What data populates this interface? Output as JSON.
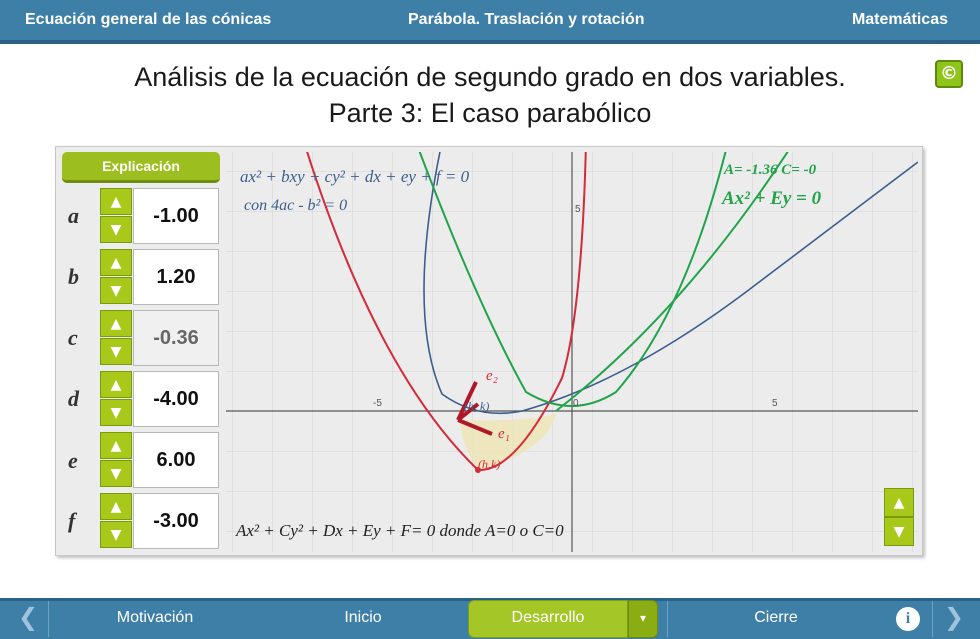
{
  "header": {
    "left_title": "Ecuación general de las cónicas",
    "center_title": "Parábola. Traslación y rotación",
    "right_title": "Matemáticas"
  },
  "copyright_icon": "©",
  "title": {
    "line1": "Análisis de la ecuación de segundo grado en dos variables.",
    "line2": "Parte 3: El caso parabólico"
  },
  "explanation_button": "Explicación",
  "params": [
    {
      "label": "a",
      "value": "-1.00",
      "disabled": false
    },
    {
      "label": "b",
      "value": "1.20",
      "disabled": false
    },
    {
      "label": "c",
      "value": "-0.36",
      "disabled": true
    },
    {
      "label": "d",
      "value": "-4.00",
      "disabled": false
    },
    {
      "label": "e",
      "value": "6.00",
      "disabled": false
    },
    {
      "label": "f",
      "value": "-3.00",
      "disabled": false
    }
  ],
  "stepper_up_icon": "▲",
  "stepper_down_icon": "▼",
  "graph": {
    "eq_general": "ax² + bxy + cy² + dx + ey + f = 0",
    "eq_condition": "con  4ac - b² = 0",
    "eq_coeffs": "A= -1.36   C= -0",
    "eq_reduced": "Ax² + Ey = 0",
    "eq_bottom": "Ax² + Cy² + Dx + Ey + F= 0  donde A=0  o  C=0",
    "tick_x_neg5": "-5",
    "tick_x_0": "0",
    "tick_x_5": "5",
    "tick_y_5": "5",
    "label_e2": "e₂",
    "label_e1": "e₁",
    "label_hk": "(h, k)",
    "label_vertex": "(h,k)",
    "colors": {
      "red": "#d42a3a",
      "blue": "#3b5e8c",
      "green": "#21a34a",
      "brown": "#b0182a"
    }
  },
  "nav": {
    "prev_icon": "❮",
    "next_icon": "❯",
    "motivacion": "Motivación",
    "inicio": "Inicio",
    "desarrollo": "Desarrollo",
    "dropdown_icon": "▾",
    "cierre": "Cierre",
    "info_icon": "i"
  }
}
